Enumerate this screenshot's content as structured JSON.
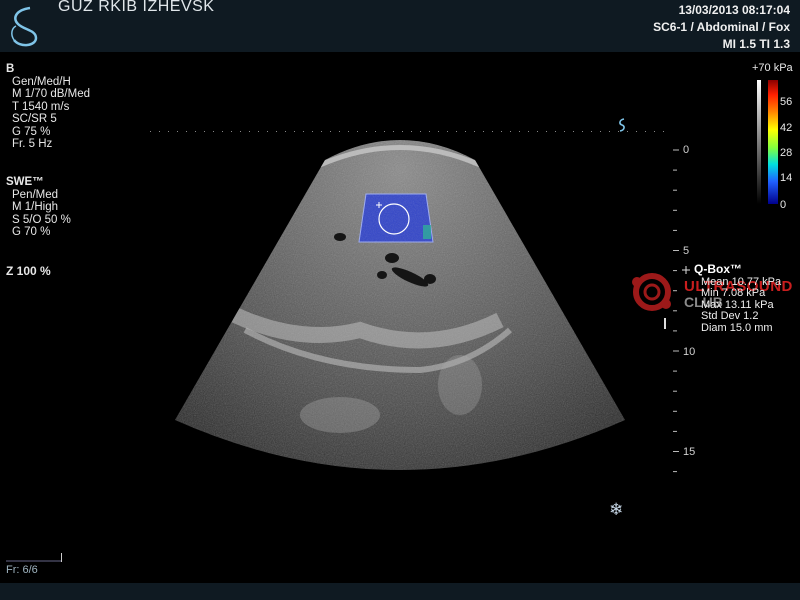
{
  "header": {
    "hospital": "GUZ RKIB IZHEVSK",
    "datetime": "13/03/2013 08:17:04",
    "preset": "SC6-1 / Abdominal / Fox",
    "indices": "MI 1.5  TI 1.3"
  },
  "bmode": {
    "title": "B",
    "lines": [
      "Gen/Med/H",
      "M 1/70 dB/Med",
      "T 1540 m/s",
      "SC/SR 5",
      "G 75 %",
      "Fr. 5 Hz"
    ]
  },
  "swe": {
    "title": "SWE™",
    "lines": [
      "Pen/Med",
      "M 1/High",
      "S 5/O 50 %",
      "G 70 %"
    ]
  },
  "zoom": "Z  100  %",
  "depth_scale": {
    "labels": [
      "0",
      "5",
      "10",
      "15"
    ],
    "values_cm": [
      0,
      5,
      10,
      15
    ]
  },
  "colorbar": {
    "max_label": "+70 kPa",
    "ticks": [
      "56",
      "42",
      "28",
      "14",
      "0"
    ]
  },
  "qbox": {
    "title": "Q-Box™",
    "mean": "Mean 10.77 kPa",
    "min": "Min 7.08 kPa",
    "max": "Max 13.11 kPa",
    "std": "Std Dev 1.2",
    "diam": "Diam 15.0 mm"
  },
  "watermark": {
    "line1": "ULTRASOUND",
    "line2": "CLUB"
  },
  "footer": {
    "frame": "Fr: 6/6"
  },
  "colors": {
    "topbar": "#0f1a22",
    "logo": "#7fc4e8",
    "swe_box": "#2a3fd0"
  },
  "icons": [
    "brand-logo-icon",
    "probe-orientation-icon",
    "snowflake-freeze-icon"
  ]
}
